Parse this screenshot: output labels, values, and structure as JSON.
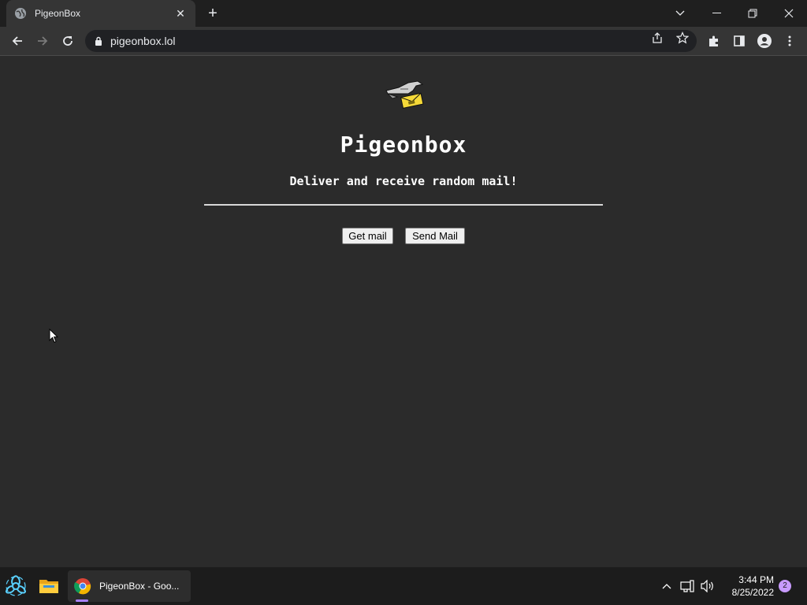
{
  "browser": {
    "tab_title": "PigeonBox",
    "url": "pigeonbox.lol"
  },
  "page": {
    "title": "Pigeonbox",
    "tagline": "Deliver and receive random mail!",
    "get_mail_label": "Get mail",
    "send_mail_label": "Send Mail"
  },
  "taskbar": {
    "chrome_label": "PigeonBox - Goo...",
    "time": "3:44 PM",
    "date": "8/25/2022",
    "notification_count": "2"
  },
  "colors": {
    "page_bg": "#2b2b2b",
    "toolbar_bg": "#353535",
    "tabstrip_bg": "#1f1f1f",
    "taskbar_bg": "#1c1c1c",
    "accent": "#a881ff"
  }
}
